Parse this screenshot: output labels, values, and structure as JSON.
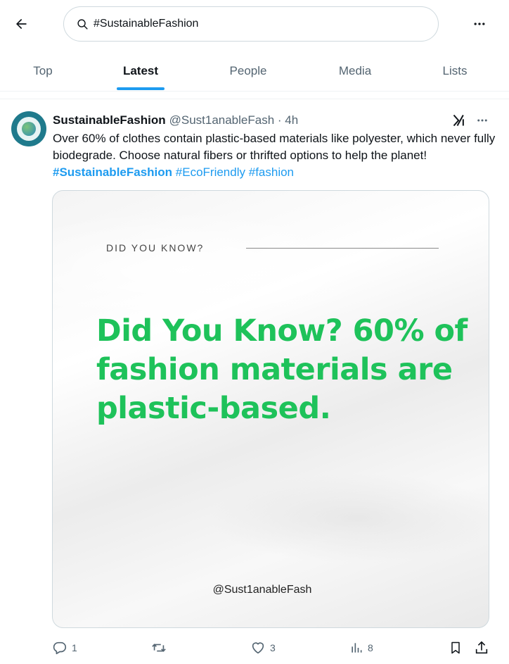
{
  "search": {
    "query": "#SustainableFashion"
  },
  "tabs": [
    {
      "label": "Top"
    },
    {
      "label": "Latest"
    },
    {
      "label": "People"
    },
    {
      "label": "Media"
    },
    {
      "label": "Lists"
    }
  ],
  "active_tab": "Latest",
  "post": {
    "display_name": "SustainableFashion",
    "handle_time": "@Sust1anableFash · 4h",
    "text": "Over 60% of clothes contain plastic-based materials like polyester, which never fully biodegrade. Choose natural fibers or thrifted options to help the planet!",
    "hashtags": [
      "#SustainableFashion",
      "#EcoFriendly",
      "#fashion"
    ],
    "media": {
      "kicker": "DID YOU KNOW?",
      "headline": "Did You Know? 60% of fashion materials are plastic-based.",
      "credit": "@Sust1anableFash"
    },
    "stats": {
      "replies": "1",
      "reposts": "",
      "likes": "3",
      "views": "8"
    }
  },
  "colors": {
    "accent": "#1d9bf0",
    "headline_green": "#1ec25a",
    "muted_text": "#536471"
  },
  "icons": [
    "back-arrow-icon",
    "search-icon",
    "more-icon",
    "grok-icon",
    "reply-icon",
    "repost-icon",
    "like-icon",
    "views-icon",
    "bookmark-icon",
    "share-icon"
  ]
}
